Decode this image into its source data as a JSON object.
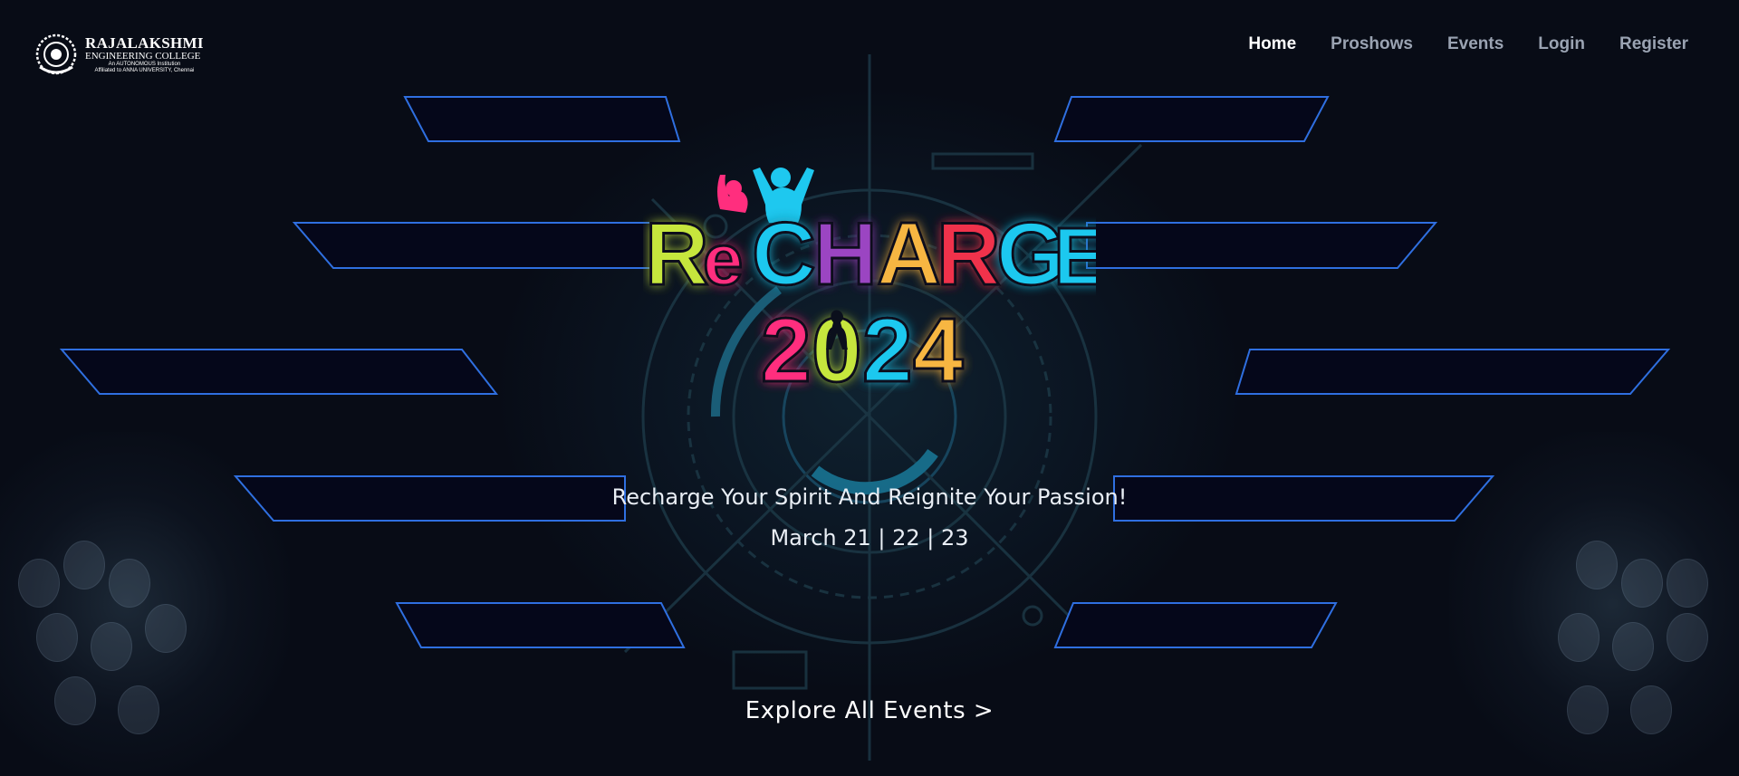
{
  "header": {
    "logo": {
      "name": "RAJALAKSHMI",
      "subtitle": "ENGINEERING COLLEGE",
      "line1": "An AUTONOMOUS Institution",
      "line2": "Affiliated to ANNA UNIVERSITY, Chennai"
    },
    "nav": [
      {
        "label": "Home",
        "active": true
      },
      {
        "label": "Proshows",
        "active": false
      },
      {
        "label": "Events",
        "active": false
      },
      {
        "label": "Login",
        "active": false
      },
      {
        "label": "Register",
        "active": false
      }
    ]
  },
  "hero": {
    "event_logo_text": "RECHARGE",
    "event_year": "2024",
    "tagline": "Recharge Your Spirit And Reignite Your Passion!",
    "dates": "March 21 | 22 | 23",
    "cta_label": "Explore All Events >"
  },
  "colors": {
    "background": "#080c16",
    "bar_border": "#2f6fe0",
    "bar_fill": "#05071a",
    "nav_active": "#ffffff",
    "nav_inactive": "#9aa3b2",
    "letter_green": "#c6e63c",
    "letter_pink": "#ff2e7e",
    "letter_purple": "#9b45c2",
    "letter_cyan": "#1ec8ef",
    "letter_orange": "#f7b643",
    "letter_red": "#f0324c"
  }
}
